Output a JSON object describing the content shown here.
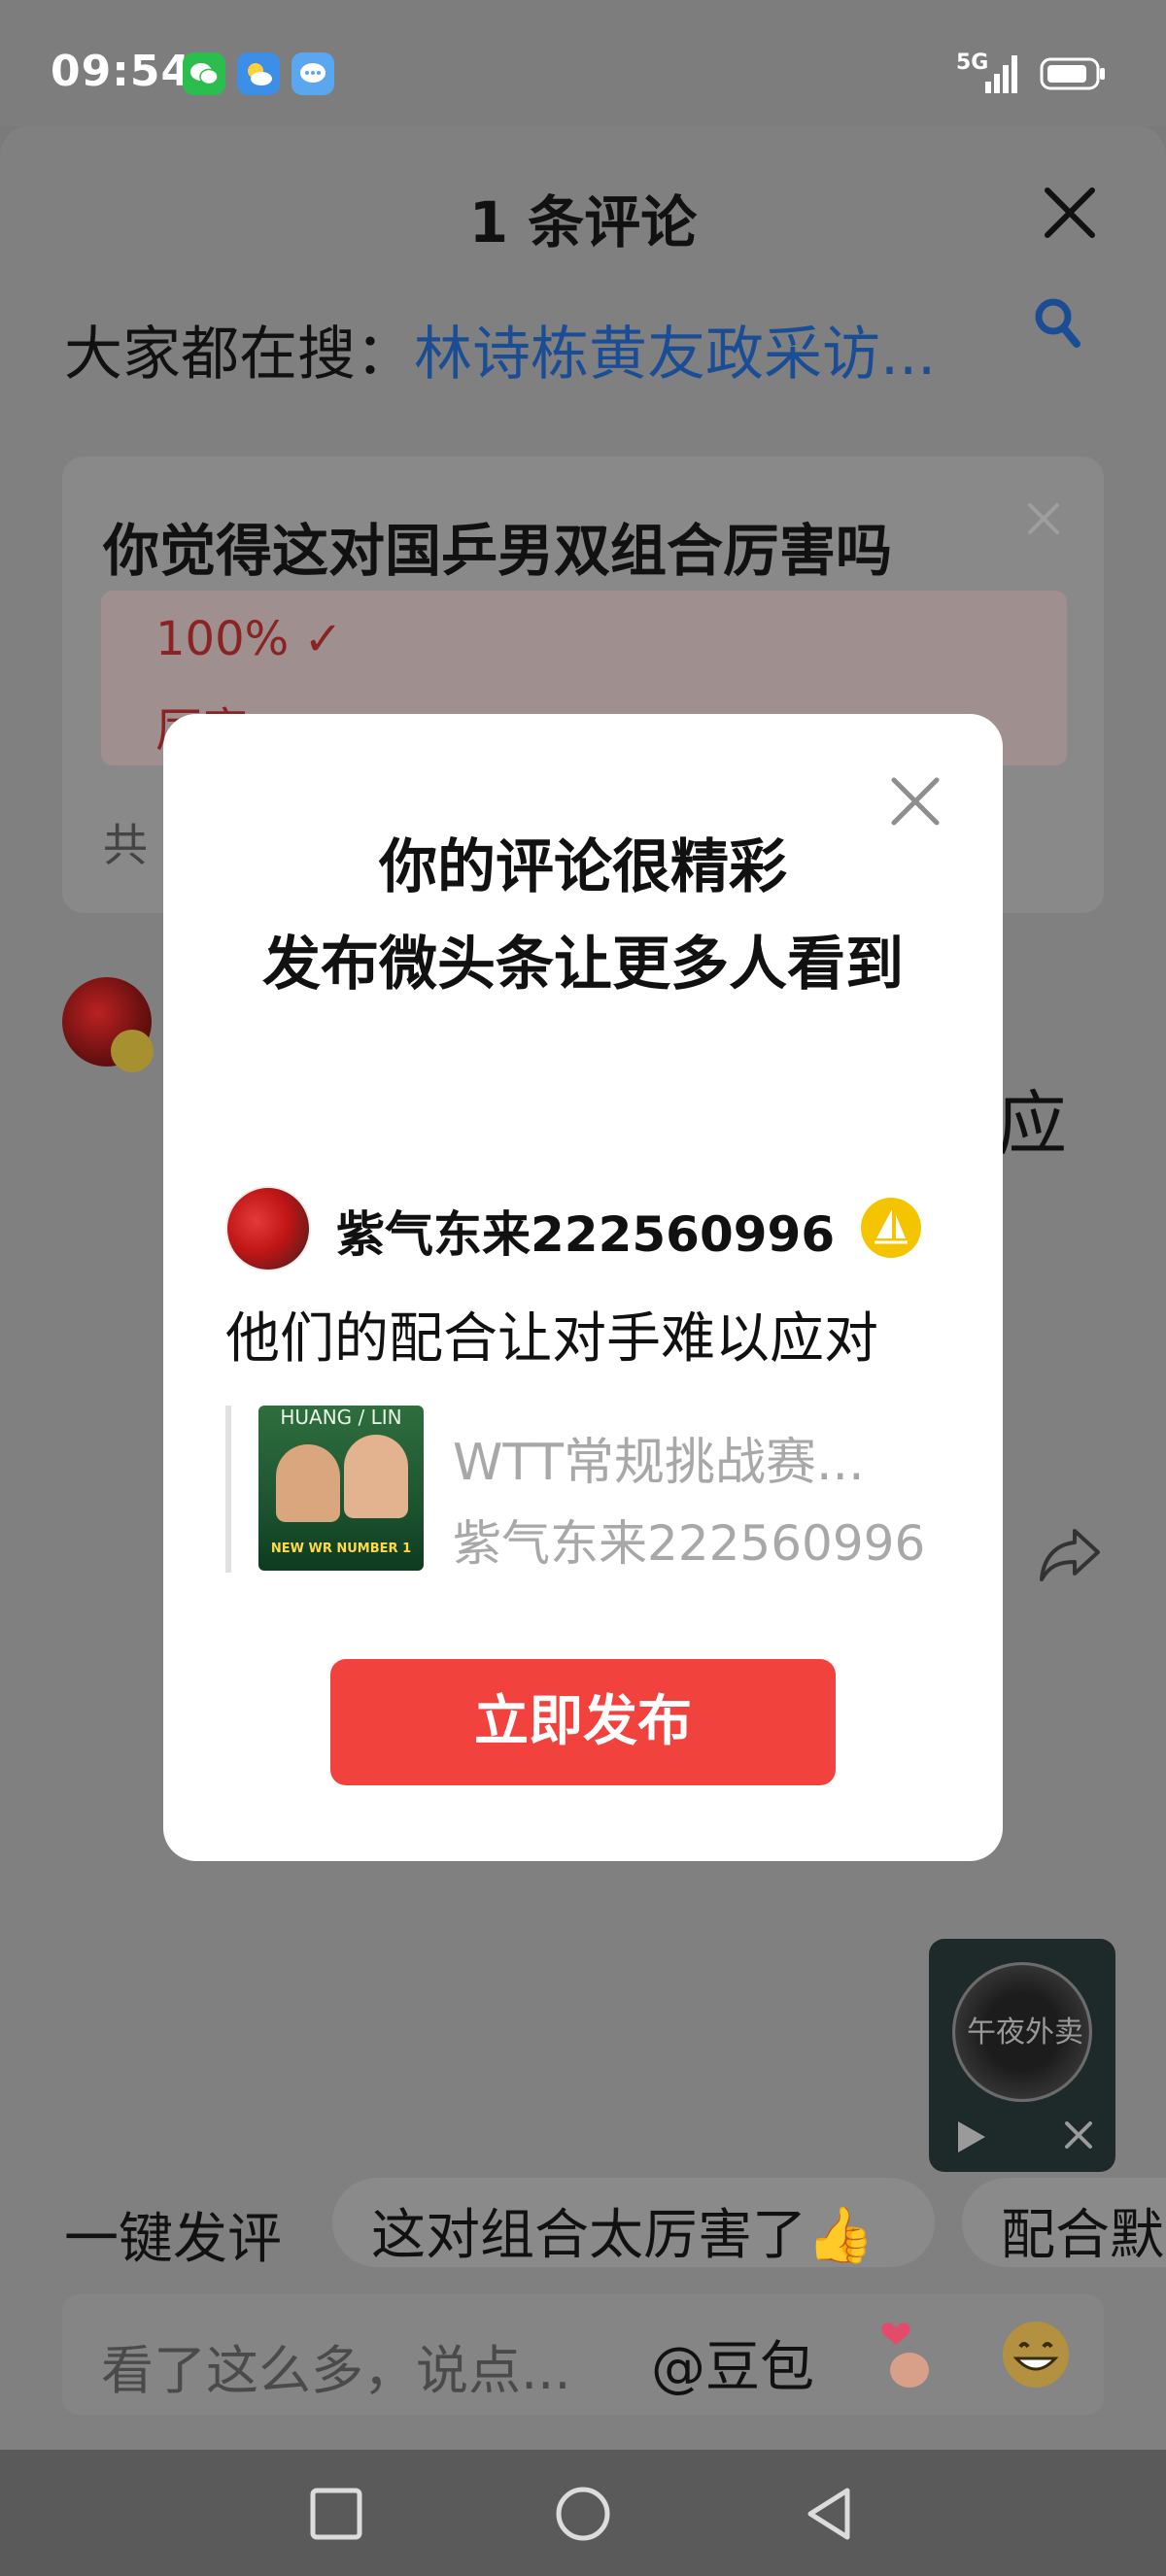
{
  "status_bar": {
    "time": "09:54",
    "network": "5G",
    "app_icons": [
      "wechat-icon",
      "weather-icon",
      "message-icon"
    ]
  },
  "comments_sheet": {
    "title": "1 条评论",
    "search": {
      "prefix": "大家都在搜：",
      "term": "林诗栋黄友政采访..."
    },
    "poll": {
      "question": "你觉得这对国乒男双组合厉害吗",
      "option_percent": "100% ✓",
      "option_label": "厉害",
      "total": "共"
    },
    "partial_text": "应"
  },
  "quick_comments": {
    "label": "一键发评",
    "chips": [
      "这对组合太厉害了👍",
      "配合默"
    ]
  },
  "input": {
    "placeholder": "看了这么多，说点...",
    "mention": "@豆包"
  },
  "mini_player": {
    "disc_text": "午夜外卖"
  },
  "modal": {
    "title_line1": "你的评论很精彩",
    "title_line2": "发布微头条让更多人看到",
    "username": "紫气东来222560996",
    "comment": "他们的配合让对手难以应对",
    "quote": {
      "title": "WTT常规挑战赛...",
      "author": "紫气东来222560996",
      "thumb_top": "HUANG / LIN",
      "thumb_bottom": "NEW WR NUMBER 1"
    },
    "publish_label": "立即发布"
  },
  "colors": {
    "accent_red": "#f2423d",
    "search_blue": "#1b4d95",
    "badge_gold": "#f5c400"
  }
}
